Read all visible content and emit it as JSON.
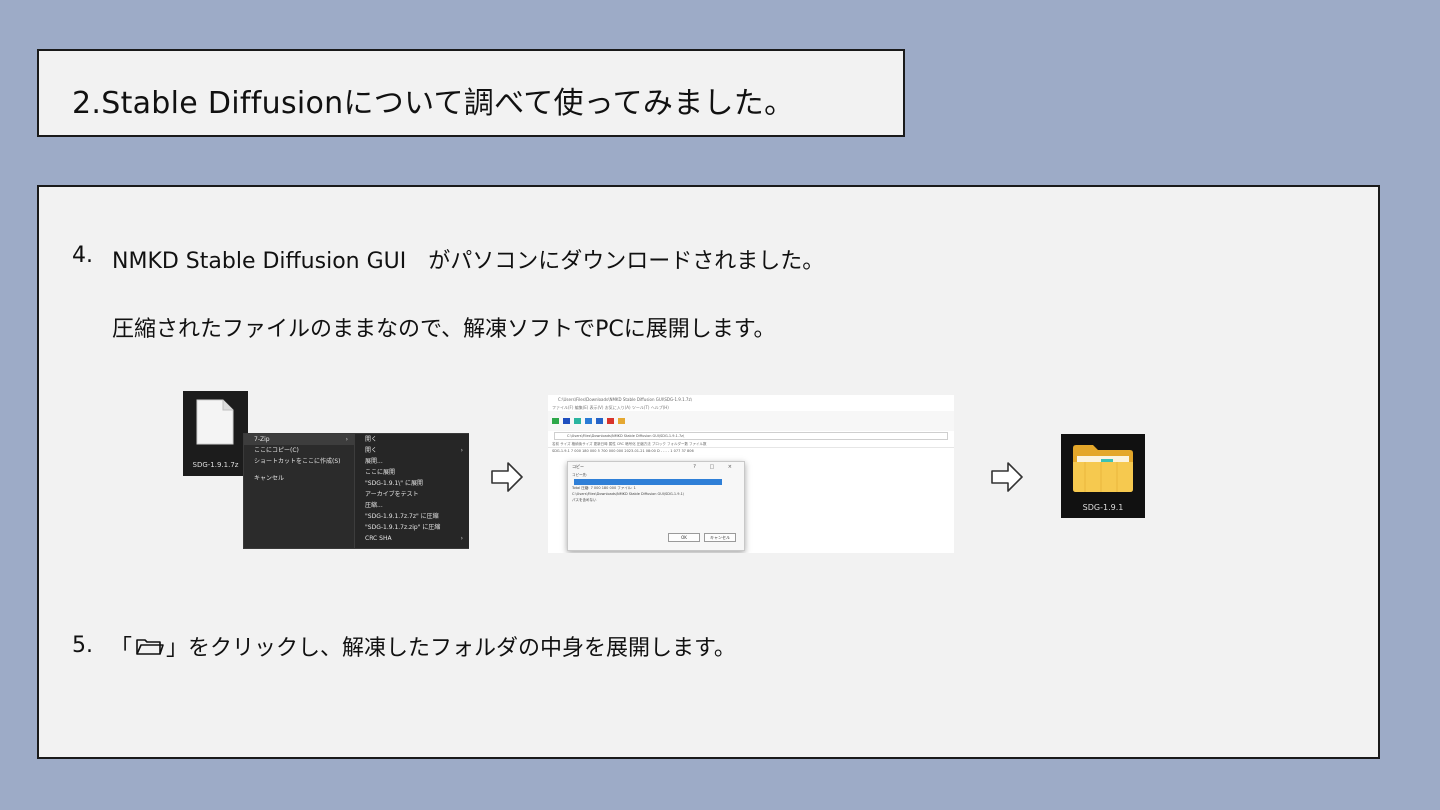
{
  "title": "2.Stable Diffusionについて調べて使ってみました。",
  "steps": [
    {
      "number": "4.",
      "text": "NMKD Stable Diffusion GUI　がパソコンにダウンロードされました。"
    },
    {
      "number": "",
      "text": "圧縮されたファイルのままなので、解凍ソフトでPCに展開します。"
    },
    {
      "number": "5.",
      "text_before": "「",
      "text_after": "」をクリックし、解凍したフォルダの中身を展開します。"
    }
  ],
  "screenshot_context_menu": {
    "file_name": "SDG-1.9.1.7z",
    "menu_items": [
      "7-Zip",
      "ここにコピー(C)",
      "ショートカットをここに作成(S)",
      "",
      "キャンセル"
    ],
    "submenu_items": [
      "開く",
      "開く",
      "展開...",
      "ここに展開",
      "\"SDG-1.9.1\\\" に展開",
      "アーカイブをテスト",
      "圧縮...",
      "\"SDG-1.9.1.7z.7z\" に圧縮",
      "\"SDG-1.9.1.7z.zip\" に圧縮",
      "CRC SHA"
    ]
  },
  "screenshot_7zip_window": {
    "window_title": "C:\\Users\\Files\\Downloads\\NMKD Stable Diffusion GUI\\SDG-1.9.1.7z\\",
    "menu": "ファイル(F)   編集(E)   表示(V)   お気に入り(A)   ツール(T)   ヘルプ(H)",
    "path": "C:\\Users\\Files\\Downloads\\NMKD Stable Diffusion GUI\\SDG-1.9.1.7z\\",
    "header": "名前          サイズ    格納後サイズ    更新日時          属性    CRC    暗号化    圧縮方法    ブロック    フォルダー数    ファイル数",
    "row": "SDG-1.9.1      7 000 180 000    5 700 000 000    2023-01-21 08:00      D     -    -     -     -     1 077     37 806",
    "dialog_title": "コピー",
    "dialog_label": "コピー先:",
    "dialog_line1": "Total 圧縮: 7 000 180 000 ファイル: 1",
    "dialog_line2": "C:\\Users\\Files\\Downloads\\NMKD Stable Diffusion GUI\\SDG-1.9.1\\",
    "dialog_line3": "パスを含めない",
    "ok_label": "OK",
    "cancel_label": "キャンセル"
  },
  "screenshot_folder": {
    "folder_name": "SDG-1.9.1"
  },
  "colors": {
    "background": "#9dabc7",
    "box": "#f2f2f2",
    "border": "#1a1a1a",
    "folder_yellow": "#f5c542"
  },
  "icons": [
    "file-icon",
    "arrow-right-icon",
    "folder-icon"
  ]
}
